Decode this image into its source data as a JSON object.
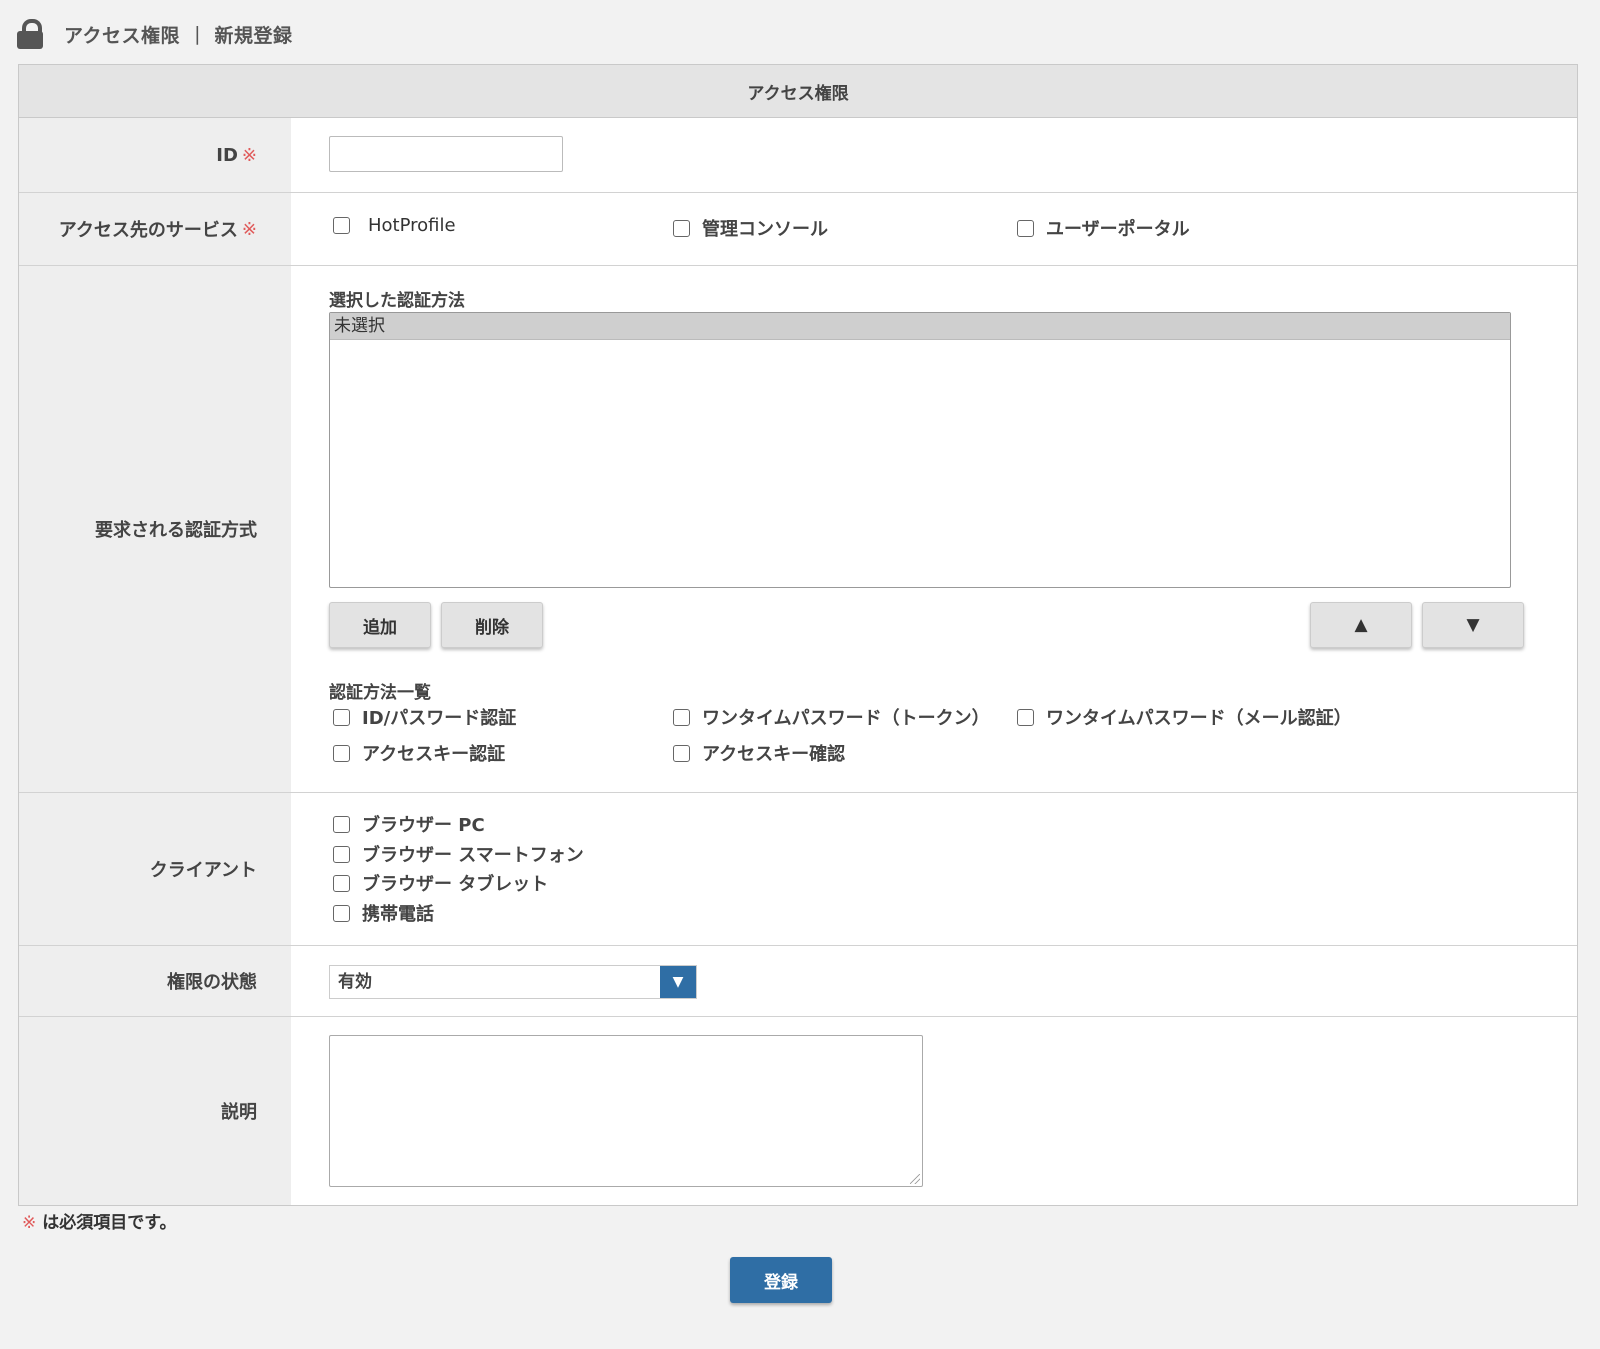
{
  "breadcrumb": {
    "section": "アクセス権限",
    "separator": "|",
    "page": "新規登録"
  },
  "form": {
    "header": "アクセス権限",
    "required_mark": "※",
    "id": {
      "label": "ID",
      "value": ""
    },
    "services": {
      "label": "アクセス先のサービス",
      "options": [
        "HotProfile",
        "管理コンソール",
        "ユーザーポータル"
      ]
    },
    "auth": {
      "label": "要求される認証方式",
      "selected_caption": "選択した認証方法",
      "selected_items": [
        "未選択"
      ],
      "add_button": "追加",
      "delete_button": "削除",
      "up_button": "▲",
      "down_button": "▼",
      "list_caption": "認証方法一覧",
      "options": [
        "ID/パスワード認証",
        "ワンタイムパスワード（トークン）",
        "ワンタイムパスワード（メール認証）",
        "アクセスキー認証",
        "アクセスキー確認"
      ]
    },
    "client": {
      "label": "クライアント",
      "options": [
        "ブラウザー PC",
        "ブラウザー スマートフォン",
        "ブラウザー タブレット",
        "携帯電話"
      ]
    },
    "status": {
      "label": "権限の状態",
      "value": "有効",
      "arrow": "▼"
    },
    "description": {
      "label": "説明",
      "value": ""
    }
  },
  "footnote": {
    "mark": "※",
    "text": "は必須項目です。"
  },
  "submit_label": "登録",
  "colors": {
    "primary": "#2f6ea5",
    "required": "#e05a5a",
    "label_bg": "#eeeeee"
  }
}
